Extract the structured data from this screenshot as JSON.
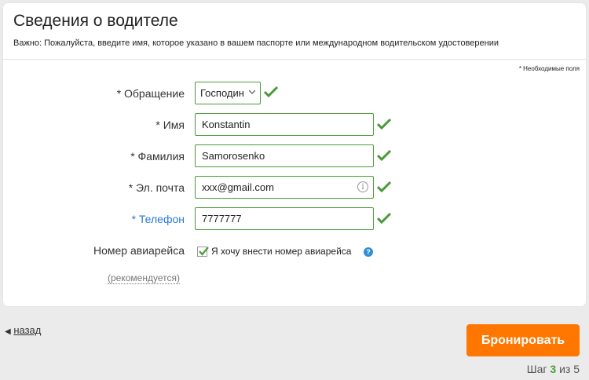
{
  "section": {
    "title": "Сведения о водителе",
    "notice": "Важно: Пожалуйста, введите имя, которое указано в вашем паспорте или международном водительском удостоверении",
    "required_note": "* Необходимые поля"
  },
  "form": {
    "salutation": {
      "label": "* Обращение",
      "value": "Господин"
    },
    "first_name": {
      "label": "* Имя",
      "value": "Konstantin"
    },
    "last_name": {
      "label": "* Фамилия",
      "value": "Samorosenko"
    },
    "email": {
      "label": "* Эл. почта",
      "value": "xxx@gmail.com",
      "info_icon": "i"
    },
    "phone": {
      "label": "* Телефон",
      "value": "7777777"
    },
    "flight": {
      "label": "Номер авиарейса",
      "checkbox_label": "Я хочу внести номер авиарейса",
      "checked": true,
      "help_icon": "?",
      "recommended": "(рекомендуется)"
    }
  },
  "footer": {
    "back_arrow": "◀",
    "back_label": "назад",
    "book_button": "Бронировать",
    "step_prefix": "Шаг",
    "step_current": "3",
    "step_of": "из",
    "step_total": "5"
  },
  "colors": {
    "accent_green": "#4a9a3a",
    "button_orange": "#ff7700",
    "phone_label_blue": "#2a7ad4",
    "help_blue": "#2e8ed6"
  },
  "icons": {
    "valid": "checkmark-icon",
    "dropdown": "chevron-down-icon",
    "info": "info-icon",
    "help": "help-icon",
    "back": "back-arrow-icon"
  }
}
